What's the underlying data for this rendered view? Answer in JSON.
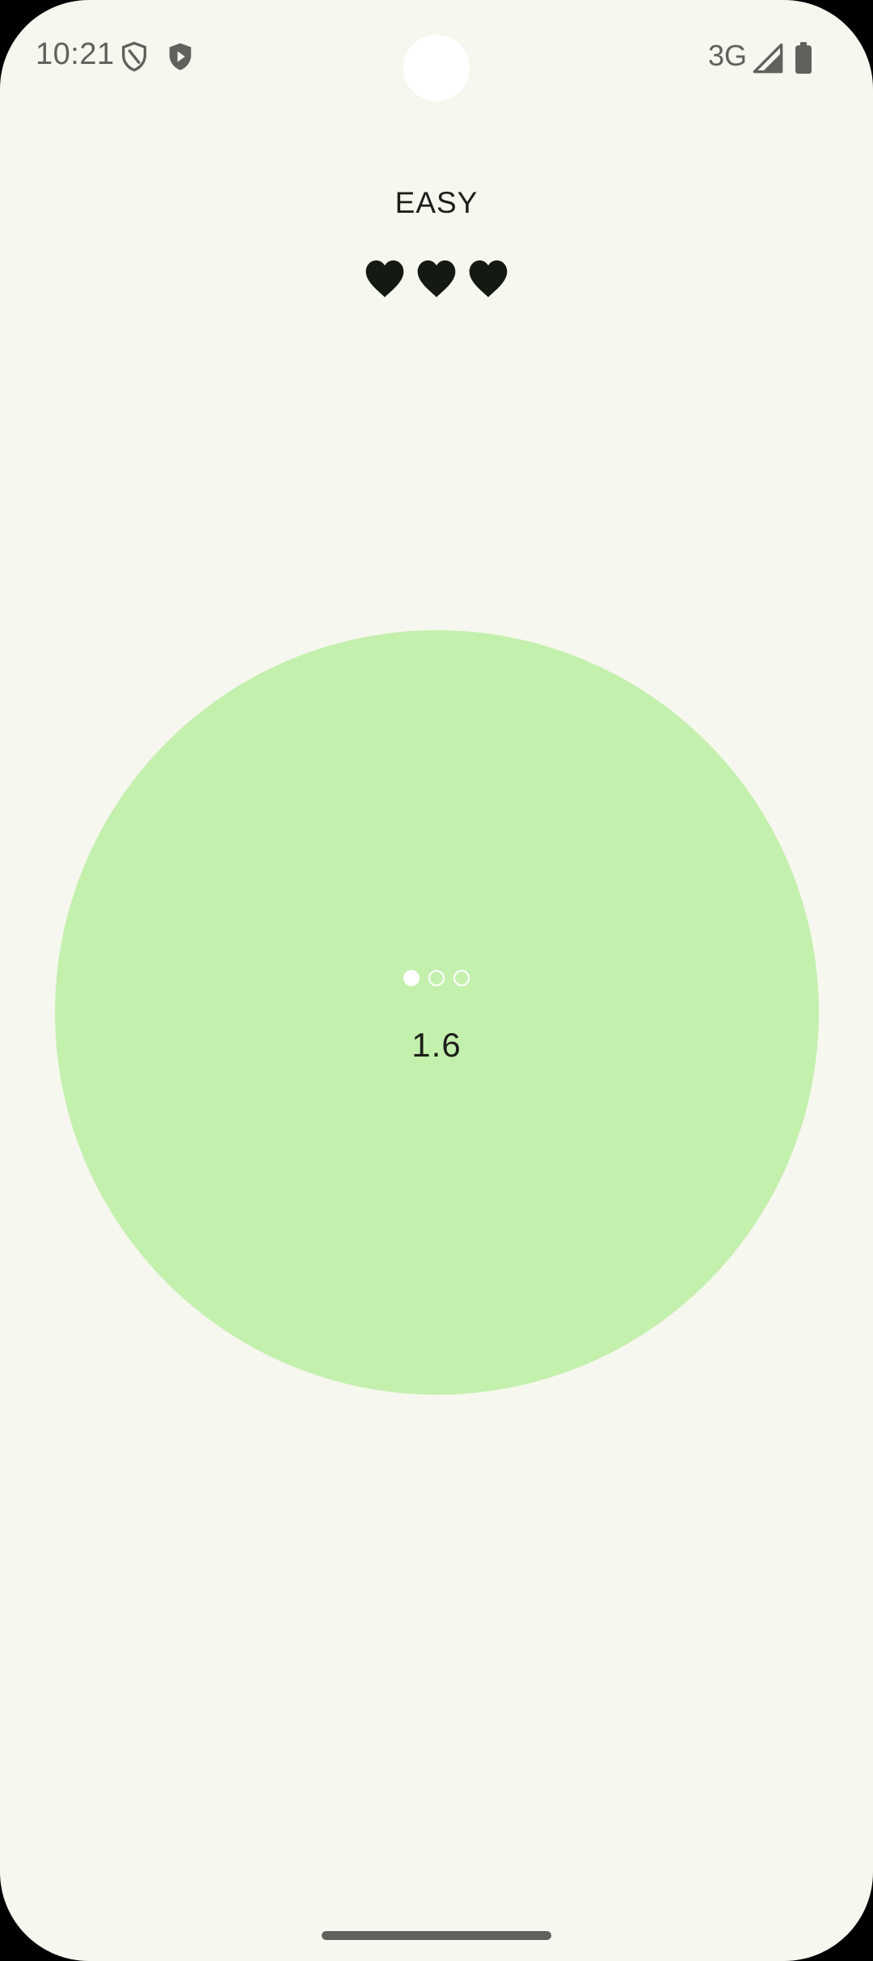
{
  "status_bar": {
    "time": "10:21",
    "icons": [
      "shield-outline-icon",
      "play-shield-icon",
      "signal-icon",
      "battery-icon"
    ],
    "network": "3G"
  },
  "game": {
    "difficulty": "EASY",
    "lives": [
      "heart-icon",
      "heart-icon",
      "heart-icon"
    ],
    "lives_count": 3,
    "progress_dots": {
      "total": 3,
      "current": 1
    },
    "value": "1.6"
  },
  "colors": {
    "background": "#f6f7ee",
    "circle": "#c4f0ae",
    "heart": "#141a12",
    "text": "#1d1f1a",
    "status": "#5f615c"
  }
}
